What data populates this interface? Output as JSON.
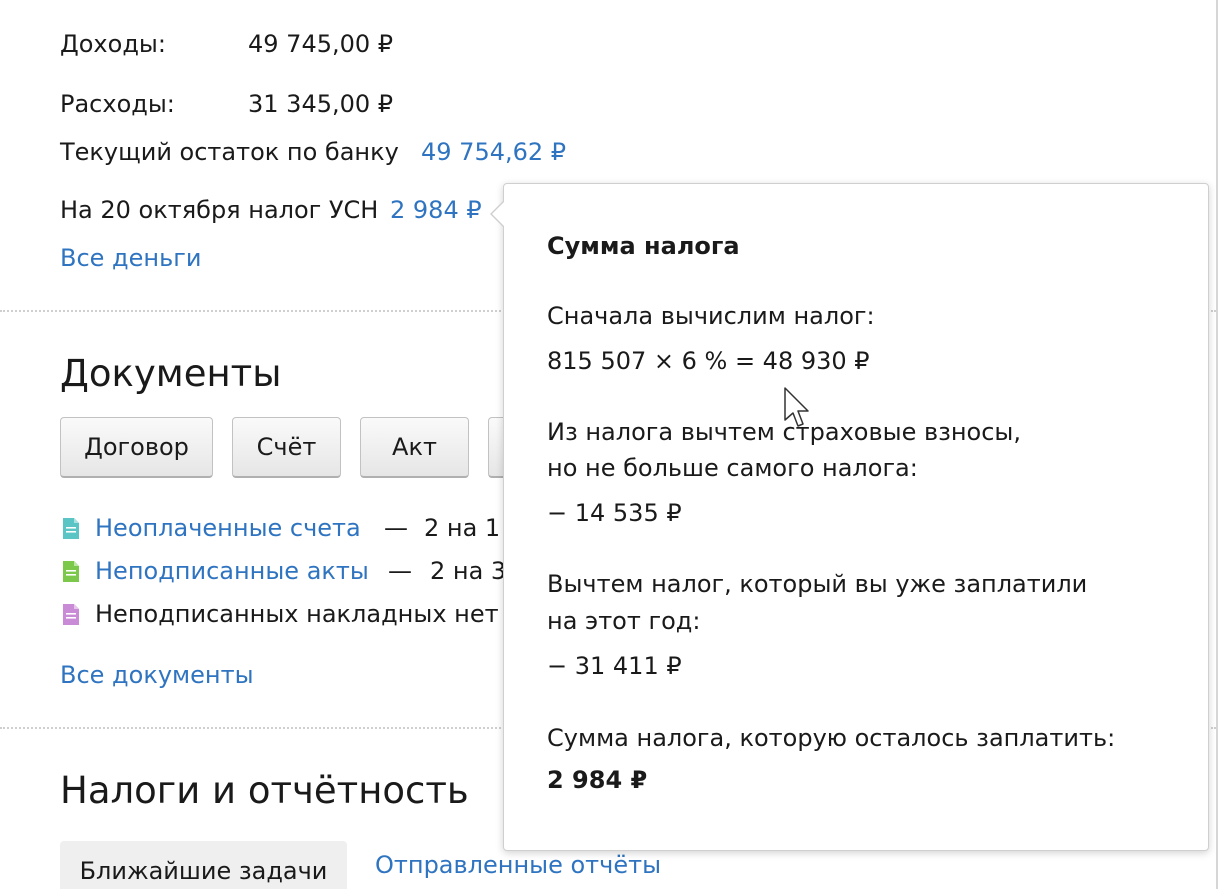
{
  "finance": {
    "income_label": "Доходы:",
    "income_value": "49 745,00 ₽",
    "expense_label": "Расходы:",
    "expense_value": "31 345,00 ₽",
    "bank_label": "Текущий остаток по банку",
    "bank_value": "49 754,62 ₽",
    "tax_label": "На 20 октября налог УСН",
    "tax_value": "2 984 ₽",
    "all_money_link": "Все деньги"
  },
  "documents": {
    "title": "Документы",
    "buttons": [
      "Договор",
      "Счёт",
      "Акт"
    ],
    "items": [
      {
        "label": "Неоплаченные счета",
        "dash": "—",
        "count": "2 на 1",
        "icon": "document-teal-icon",
        "color": "#5bc4c4",
        "is_link": true
      },
      {
        "label": "Неподписанные акты",
        "dash": "—",
        "count": "2 на 3",
        "icon": "document-green-icon",
        "color": "#7cc84a",
        "is_link": true
      },
      {
        "label": "Неподписанных накладных нет",
        "dash": "",
        "count": "",
        "icon": "document-purple-icon",
        "color": "#c98ad6",
        "is_link": false
      }
    ],
    "all_docs_link": "Все документы"
  },
  "taxes": {
    "title": "Налоги и отчётность",
    "tabs": [
      "Ближайшие задачи",
      "Отправленные отчёты"
    ]
  },
  "popover": {
    "title": "Сумма налога",
    "step1_label": "Сначала вычислим налог:",
    "step1_formula": "815 507 × 6 % = 48 930 ₽",
    "step2_line1": "Из налога вычтем страховые взносы,",
    "step2_line2": "но не больше самого налога:",
    "step2_value": "− 14 535 ₽",
    "step3_line1": "Вычтем налог, который вы уже заплатили",
    "step3_line2": "на этот год:",
    "step3_value": "− 31 411 ₽",
    "result_label": "Сумма налога, которую осталось заплатить:",
    "result_value": "2 984 ₽"
  },
  "colors": {
    "link": "#2f74c0",
    "text": "#1a1a1a"
  }
}
